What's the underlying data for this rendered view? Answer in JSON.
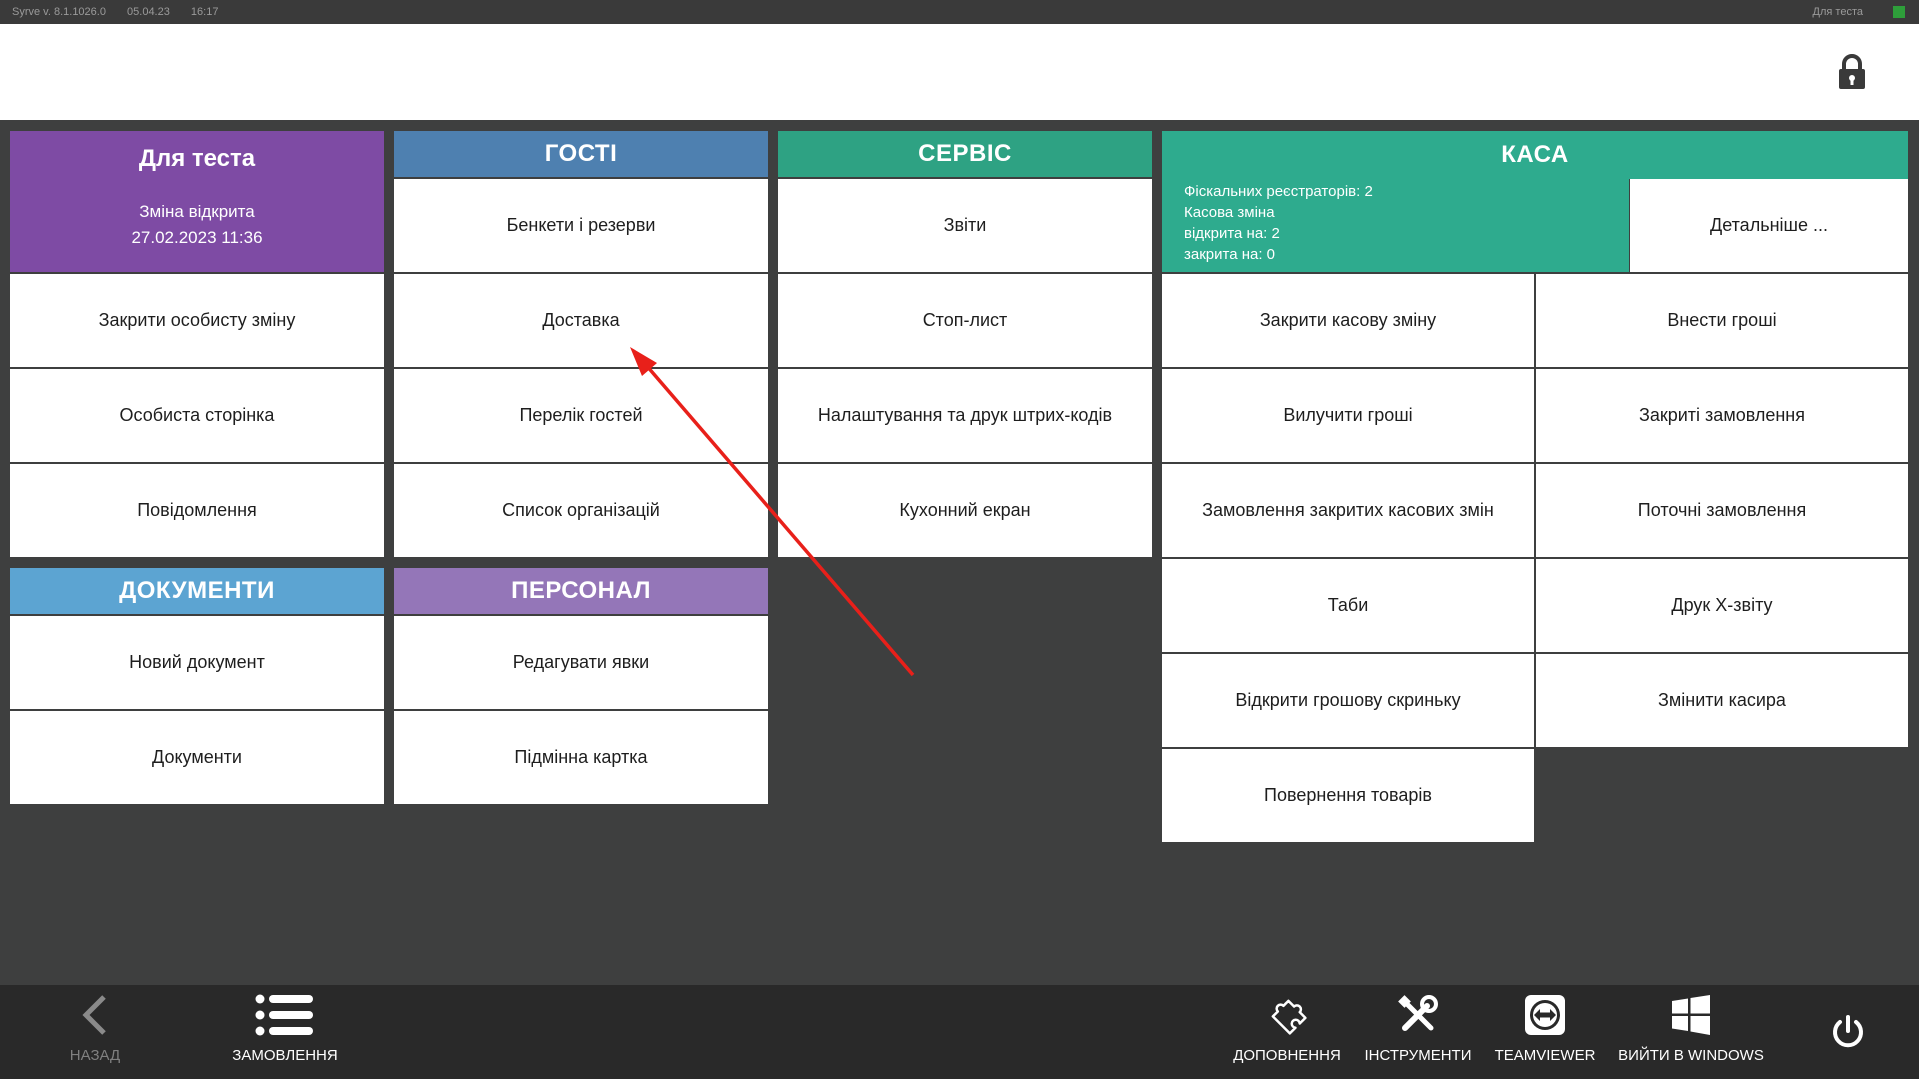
{
  "statusbar": {
    "version": "Syrve v. 8.1.1026.0",
    "date": "05.04.23",
    "time": "16:17",
    "user": "Для теста"
  },
  "personal": {
    "title": "Для теста",
    "shift_status": "Зміна відкрита",
    "shift_date": "27.02.2023 11:36",
    "items": [
      "Закрити особисту зміну",
      "Особиста сторінка",
      "Повідомлення"
    ]
  },
  "guests": {
    "title": "ГОСТІ",
    "items": [
      "Бенкети і резерви",
      "Доставка",
      "Перелік гостей",
      "Список організацій"
    ]
  },
  "service": {
    "title": "СЕРВІС",
    "items": [
      "Звіти",
      "Стоп-лист",
      "Налаштування та друк штрих-кодів",
      "Кухонний екран"
    ]
  },
  "kasa": {
    "title": "КАСА",
    "info": [
      "Фіскальних реєстраторів: 2",
      "Касова зміна",
      "відкрита на: 2",
      "закрита на: 0"
    ],
    "details": "Детальніше ...",
    "items": [
      "Закрити касову зміну",
      "Внести гроші",
      "Вилучити гроші",
      "Закриті замовлення",
      "Замовлення закритих касових змін",
      "Поточні замовлення",
      "Таби",
      "Друк Х-звіту",
      "Відкрити грошову скриньку",
      "Змінити касира",
      "Повернення товарів"
    ]
  },
  "documents": {
    "title": "ДОКУМЕНТИ",
    "items": [
      "Новий документ",
      "Документи"
    ]
  },
  "staff": {
    "title": "ПЕРСОНАЛ",
    "items": [
      "Редагувати явки",
      "Підмінна картка"
    ]
  },
  "bottombar": {
    "back": "НАЗАД",
    "orders": "ЗАМОВЛЕННЯ",
    "addons": "ДОПОВНЕННЯ",
    "tools": "ІНСТРУМЕНТИ",
    "teamviewer": "TEAMVIEWER",
    "exit_windows": "ВИЙТИ В WINDOWS"
  },
  "icons": {
    "lock": "lock-icon",
    "back": "chevron-left-icon",
    "orders": "list-icon",
    "addons": "puzzle-icon",
    "tools": "tools-icon",
    "teamviewer": "teamviewer-icon",
    "windows": "windows-icon",
    "power": "power-icon"
  },
  "colors": {
    "personal": "#7e4ba4",
    "guests": "#4e80b0",
    "service": "#2ea283",
    "kasa": "#2eab8e",
    "documents": "#5ca4d2",
    "staff": "#9476b8",
    "annotation_arrow": "#e8201a",
    "status_indicator": "#2e9e3a"
  }
}
